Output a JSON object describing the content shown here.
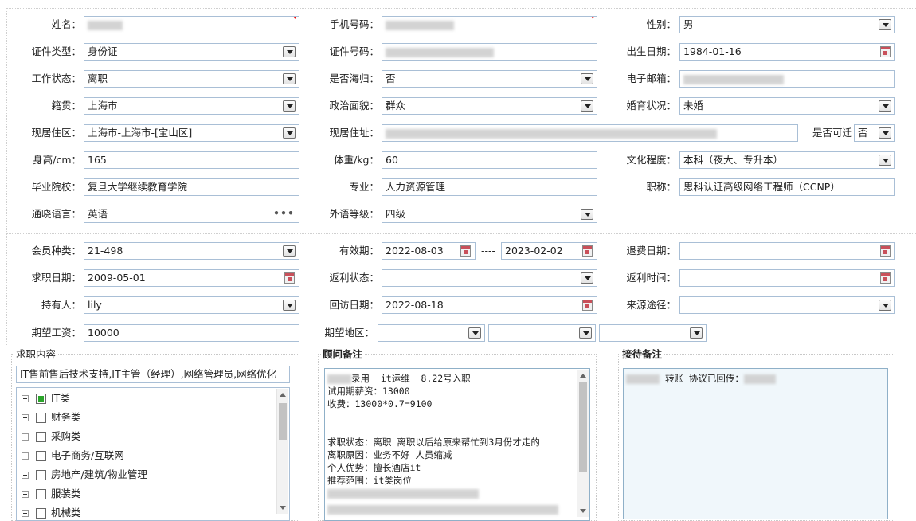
{
  "basic": {
    "name": {
      "label": "姓名：",
      "value": "",
      "required": "*"
    },
    "phone": {
      "label": "手机号码：",
      "value": "",
      "required": "*"
    },
    "gender": {
      "label": "性别：",
      "value": "男"
    },
    "id_type": {
      "label": "证件类型：",
      "value": "身份证"
    },
    "id_number": {
      "label": "证件号码：",
      "value": ""
    },
    "birthdate": {
      "label": "出生日期：",
      "value": "1984-01-16"
    },
    "work_status": {
      "label": "工作状态：",
      "value": "离职"
    },
    "returnee": {
      "label": "是否海归：",
      "value": "否"
    },
    "email": {
      "label": "电子邮箱：",
      "value": ""
    },
    "native_place": {
      "label": "籍贯：",
      "value": "上海市"
    },
    "political": {
      "label": "政治面貌：",
      "value": "群众"
    },
    "marital": {
      "label": "婚育状况：",
      "value": "未婚"
    },
    "residence_area": {
      "label": "现居住区：",
      "value": "上海市-上海市-[宝山区]"
    },
    "address": {
      "label": "现居住址：",
      "value": ""
    },
    "relocate": {
      "label": "是否可迁",
      "value": "否"
    },
    "height": {
      "label": "身高/cm：",
      "value": "165"
    },
    "weight": {
      "label": "体重/kg：",
      "value": "60"
    },
    "education": {
      "label": "文化程度：",
      "value": "本科（夜大、专升本）"
    },
    "school": {
      "label": "毕业院校：",
      "value": "复旦大学继续教育学院"
    },
    "major": {
      "label": "专业：",
      "value": "人力资源管理"
    },
    "title": {
      "label": "职称：",
      "value": "思科认证高级网络工程师（CCNP）"
    },
    "language": {
      "label": "通晓语言：",
      "value": "英语",
      "more": "•••"
    },
    "foreign_level": {
      "label": "外语等级：",
      "value": "四级"
    }
  },
  "membership": {
    "member_type": {
      "label": "会员种类：",
      "value": "21-498"
    },
    "validity": {
      "label": "有效期：",
      "from": "2022-08-03",
      "separator": "----",
      "to": "2023-02-02"
    },
    "refund_date": {
      "label": "退费日期：",
      "value": ""
    },
    "job_date": {
      "label": "求职日期：",
      "value": "2009-05-01"
    },
    "rebate_status": {
      "label": "返利状态：",
      "value": ""
    },
    "rebate_time": {
      "label": "返利时间：",
      "value": ""
    },
    "holder": {
      "label": "持有人：",
      "value": "lily"
    },
    "visit_date": {
      "label": "回访日期：",
      "value": "2022-08-18"
    },
    "source": {
      "label": "来源途径：",
      "value": ""
    },
    "salary": {
      "label": "期望工资：",
      "value": "10000"
    },
    "region": {
      "label": "期望地区：",
      "values": [
        "",
        "",
        ""
      ]
    }
  },
  "job_content": {
    "title": "求职内容",
    "summary": "IT售前售后技术支持,IT主管（经理）,网络管理员,网络优化",
    "tree": [
      {
        "label": "IT类",
        "state": "partial"
      },
      {
        "label": "财务类",
        "state": "unchecked"
      },
      {
        "label": "采购类",
        "state": "unchecked"
      },
      {
        "label": "电子商务/互联网",
        "state": "unchecked"
      },
      {
        "label": "房地产/建筑/物业管理",
        "state": "unchecked"
      },
      {
        "label": "服装类",
        "state": "unchecked"
      },
      {
        "label": "机械类",
        "state": "unchecked"
      }
    ]
  },
  "advisor_notes": {
    "title": "顾问备注",
    "lines": [
      {
        "pre": "",
        "text": "录用  it运维  8.22号入职"
      },
      {
        "pre": "",
        "text": "试用期薪资：13000"
      },
      {
        "pre": "",
        "text": "收费：13000*0.7=9100"
      },
      {
        "pre": "",
        "text": ""
      },
      {
        "pre": "",
        "text": ""
      },
      {
        "pre": "",
        "text": "求职状态：离职 离职以后给原来帮忙到3月份才走的"
      },
      {
        "pre": "",
        "text": "离职原因：业务不好 人员缩减"
      },
      {
        "pre": "",
        "text": "个人优势：擅长酒店it"
      },
      {
        "pre": "",
        "text": "推荐范围：it类岗位"
      }
    ]
  },
  "reception_notes": {
    "title": "接待备注",
    "text": "转账 协议已回传："
  }
}
